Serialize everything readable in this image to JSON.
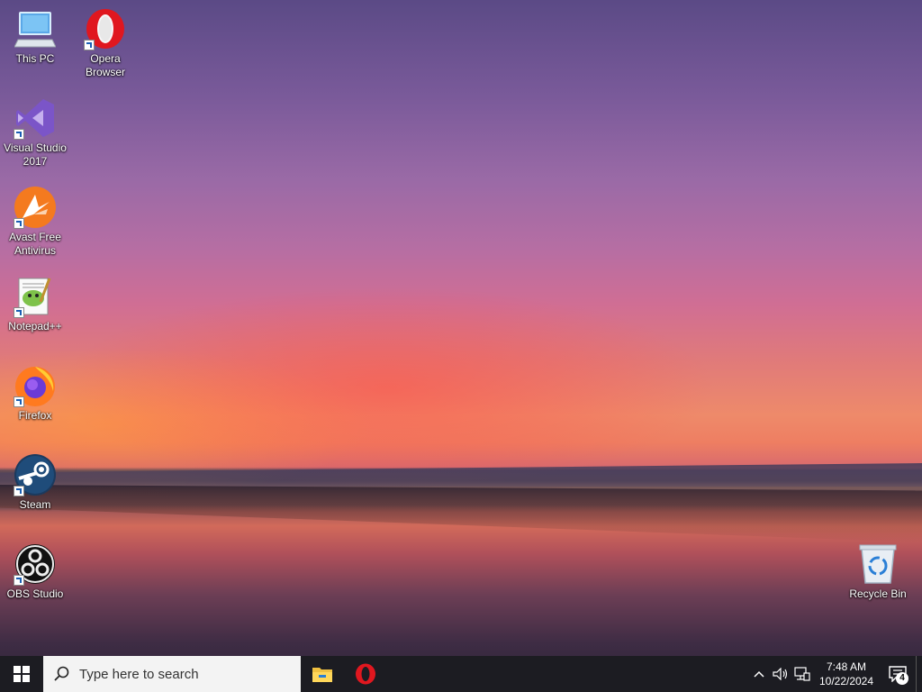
{
  "desktop": {
    "icons": [
      {
        "label": "This PC",
        "icon": "this-pc-icon"
      },
      {
        "label": "Opera\nBrowser",
        "icon": "opera-icon"
      },
      {
        "label": "Visual Studio\n2017",
        "icon": "visual-studio-icon"
      },
      {
        "label": "Avast Free\nAntivirus",
        "icon": "avast-icon"
      },
      {
        "label": "Notepad++",
        "icon": "notepad-plus-plus-icon"
      },
      {
        "label": "Firefox",
        "icon": "firefox-icon"
      },
      {
        "label": "Steam",
        "icon": "steam-icon"
      },
      {
        "label": "OBS Studio",
        "icon": "obs-studio-icon"
      },
      {
        "label": "Recycle Bin",
        "icon": "recycle-bin-icon"
      }
    ]
  },
  "taskbar": {
    "search_placeholder": "Type here to search",
    "pinned": [
      {
        "icon": "file-explorer-icon"
      },
      {
        "icon": "opera-icon"
      }
    ],
    "clock_time": "7:48 AM",
    "clock_date": "10/22/2024",
    "notification_count": "4"
  },
  "colors": {
    "taskbar_bg": "#1c1c22",
    "opera_red": "#e0171f",
    "windows_blue": "#ffffff"
  }
}
